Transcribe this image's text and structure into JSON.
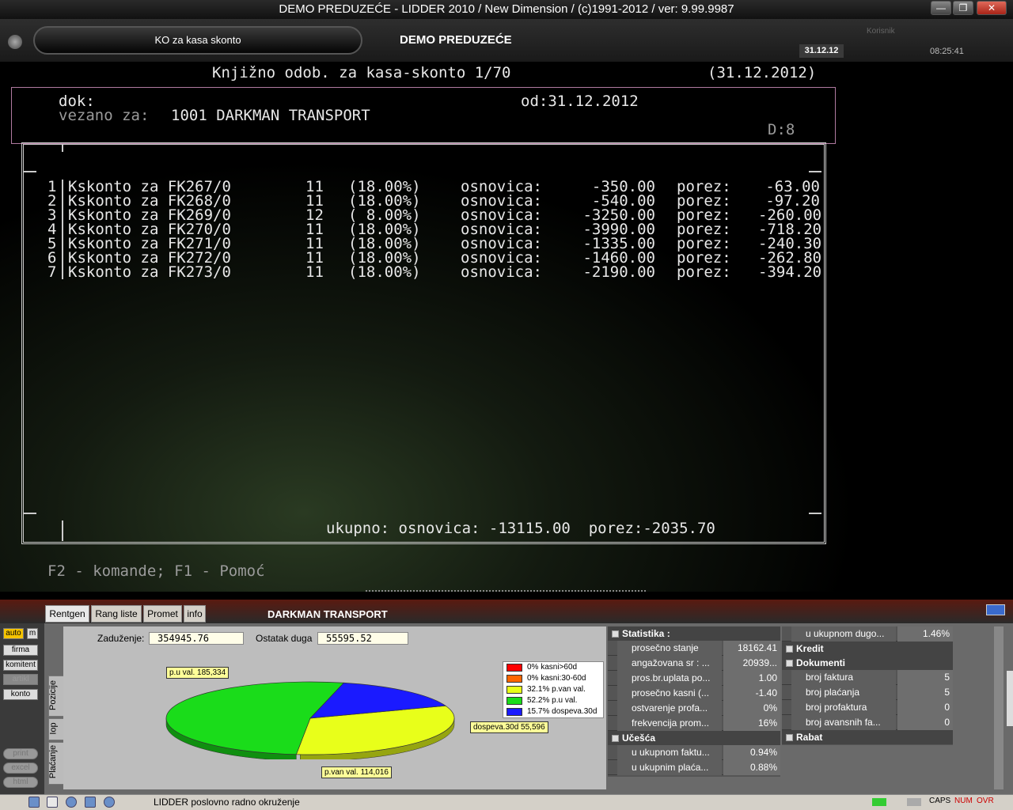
{
  "window": {
    "title": "DEMO PREDUZEĆE - LIDDER 2010 / New Dimension / (c)1991-2012 / ver: 9.99.9987"
  },
  "header": {
    "module": "KO za kasa skonto",
    "company": "DEMO PREDUZEĆE",
    "user_label": "Korisnik",
    "date": "31.12.12",
    "time": "08:25:41"
  },
  "term": {
    "title": "Knjižno odob. za kasa-skonto 1/70",
    "title_date": "(31.12.2012)",
    "dok_label": "dok:",
    "od": "od:31.12.2012",
    "vezano_label": "vezano za:",
    "vezano_value": "1001 DARKMAN TRANSPORT",
    "d": "D:8",
    "rows": [
      {
        "n": "1",
        "doc": "Kskonto za FK267/0",
        "code": "11",
        "rate": "(18.00%)",
        "osn_label": "osnovica:",
        "osn": "-350.00",
        "por_label": "porez:",
        "por": "-63.00"
      },
      {
        "n": "2",
        "doc": "Kskonto za FK268/0",
        "code": "11",
        "rate": "(18.00%)",
        "osn_label": "osnovica:",
        "osn": "-540.00",
        "por_label": "porez:",
        "por": "-97.20"
      },
      {
        "n": "3",
        "doc": "Kskonto za FK269/0",
        "code": "12",
        "rate": "( 8.00%)",
        "osn_label": "osnovica:",
        "osn": "-3250.00",
        "por_label": "porez:",
        "por": "-260.00"
      },
      {
        "n": "4",
        "doc": "Kskonto za FK270/0",
        "code": "11",
        "rate": "(18.00%)",
        "osn_label": "osnovica:",
        "osn": "-3990.00",
        "por_label": "porez:",
        "por": "-718.20"
      },
      {
        "n": "5",
        "doc": "Kskonto za FK271/0",
        "code": "11",
        "rate": "(18.00%)",
        "osn_label": "osnovica:",
        "osn": "-1335.00",
        "por_label": "porez:",
        "por": "-240.30"
      },
      {
        "n": "6",
        "doc": "Kskonto za FK272/0",
        "code": "11",
        "rate": "(18.00%)",
        "osn_label": "osnovica:",
        "osn": "-1460.00",
        "por_label": "porez:",
        "por": "-262.80"
      },
      {
        "n": "7",
        "doc": "Kskonto za FK273/0",
        "code": "11",
        "rate": "(18.00%)",
        "osn_label": "osnovica:",
        "osn": "-2190.00",
        "por_label": "porez:",
        "por": "-394.20"
      }
    ],
    "total": "ukupno: osnovica: -13115.00  porez:-2035.70",
    "help": "F2 - komande; F1 - Pomoć"
  },
  "panel": {
    "tabs": [
      "Rentgen",
      "Rang liste",
      "Promet",
      "info"
    ],
    "name": "DARKMAN TRANSPORT",
    "side_buttons": [
      "auto",
      "m",
      "firma",
      "komitent",
      "artikl",
      "konto"
    ],
    "vtabs": [
      "Pozicije",
      "Iop",
      "Plaćanje"
    ],
    "export": [
      "print",
      "excel",
      "html"
    ],
    "zaduzenje_label": "Zaduženje:",
    "zaduzenje": "354945.76",
    "ostatak_label": "Ostatak duga",
    "ostatak": "55595.52"
  },
  "chart_data": {
    "type": "pie",
    "slices": [
      {
        "label": "kasni>60d",
        "pct": 0,
        "color": "#ff0000"
      },
      {
        "label": "kasni:30-60d",
        "pct": 0,
        "color": "#ff6600"
      },
      {
        "label": "p.van val.",
        "pct": 32.1,
        "color": "#e8ff1a",
        "value": 114016
      },
      {
        "label": "p.u val.",
        "pct": 52.2,
        "color": "#1adc1a",
        "value": 185334
      },
      {
        "label": "dospeva.30d",
        "pct": 15.7,
        "color": "#1a1aff",
        "value": 55596
      }
    ],
    "legend": [
      "0% kasni>60d",
      "0% kasni:30-60d",
      "32.1% p.van val.",
      "52.2% p.u val.",
      "15.7% dospeva.30d"
    ],
    "callouts": [
      "p.u val. 185,334",
      "dospeva.30d 55,596",
      "p.van val. 114,016"
    ]
  },
  "stats": {
    "statistika": "Statistika :",
    "rows": [
      {
        "k": "prosečno stanje",
        "v": "18162.41"
      },
      {
        "k": "angažovana sr : ...",
        "v": "20939..."
      },
      {
        "k": "pros.br.uplata po...",
        "v": "1.00"
      },
      {
        "k": "prosečno kasni (...",
        "v": "-1.40"
      },
      {
        "k": "ostvarenje profa...",
        "v": "0%"
      },
      {
        "k": "frekvencija prom...",
        "v": "16%"
      }
    ],
    "ucesca": "Učešća",
    "ucesca_rows": [
      {
        "k": "u ukupnom faktu...",
        "v": "0.94%"
      },
      {
        "k": "u ukupnim plaća...",
        "v": "0.88%"
      }
    ],
    "right_top": {
      "k": "u ukupnom dugo...",
      "v": "1.46%"
    },
    "kredit": "Kredit",
    "dokumenti": "Dokumenti",
    "dok_rows": [
      {
        "k": "broj faktura",
        "v": "5"
      },
      {
        "k": "broj plaćanja",
        "v": "5"
      },
      {
        "k": "broj profaktura",
        "v": "0"
      },
      {
        "k": "broj avansnih fa...",
        "v": "0"
      }
    ],
    "rabat": "Rabat"
  },
  "status": {
    "text": "LIDDER poslovno radno okruženje",
    "caps": "CAPS",
    "num": "NUM",
    "ovr": "OVR"
  }
}
